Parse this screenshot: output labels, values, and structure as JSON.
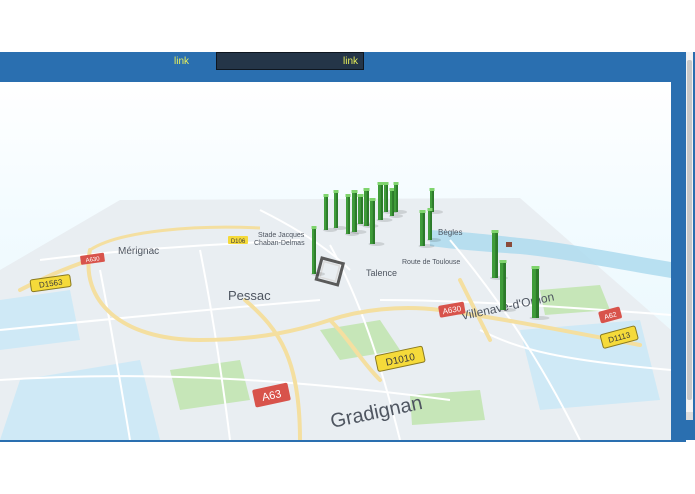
{
  "nav": {
    "link_1": "link",
    "link_2": "link"
  },
  "map": {
    "view": "3d-perspective",
    "places": {
      "merignac": "Mérignac",
      "stade_1": "Stade Jacques",
      "stade_2": "Chaban-Delmas",
      "pessac": "Pessac",
      "talence": "Talence",
      "route": "Route de Toulouse",
      "begles": "Bègles",
      "villenave": "Villenave-d'Ornon",
      "gradignan": "Gradignan"
    },
    "roads": {
      "a630": "A630",
      "a63": "A63",
      "d1010": "D1010",
      "d1563": "D1563",
      "d1113": "D1113",
      "a62": "A62",
      "d106": "D106",
      "a630_west": "A630"
    },
    "colors": {
      "water": "#aedbef",
      "land": "#e9eef2",
      "roads": "#ffffff",
      "major_roads": "#f4dfa0",
      "parks": "#c6e6b8",
      "columns": "#3f9c3a",
      "column_tops": "#7fd46d",
      "highway_shield": "#d8534b",
      "departmental_shield": "#f5da3a"
    }
  }
}
